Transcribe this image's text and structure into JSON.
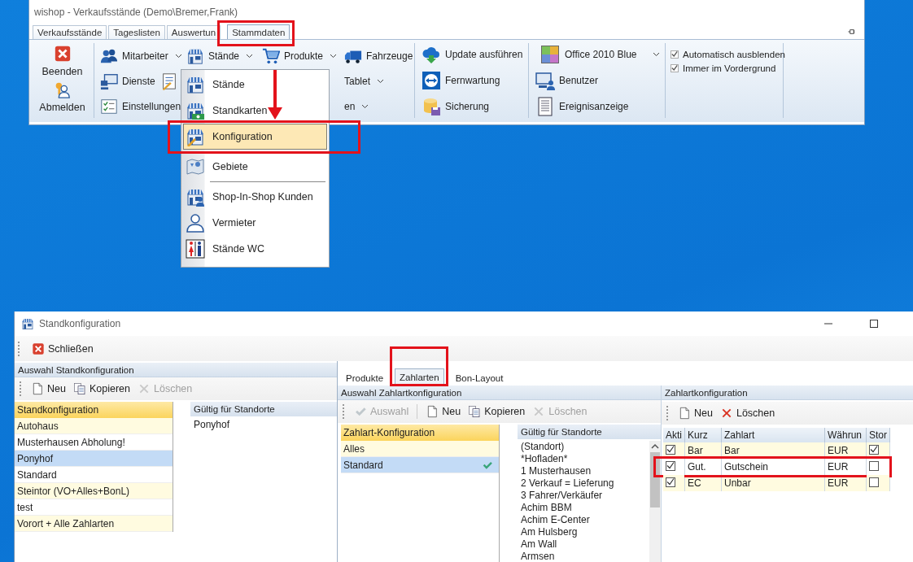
{
  "main_window": {
    "title": "wishop - Verkaufsstände (Demo\\Bremer,Frank)",
    "tabs": [
      {
        "label": "Verkaufsstände",
        "selected": false,
        "highlighted": false
      },
      {
        "label": "Tageslisten",
        "selected": false,
        "highlighted": false
      },
      {
        "label": "Auswertun",
        "selected": false,
        "highlighted": false
      },
      {
        "label": "Stammdaten",
        "selected": true,
        "highlighted": true
      }
    ],
    "ribbon": {
      "groups": [
        {
          "kind": "large",
          "items": [
            {
              "label": "Beenden"
            },
            {
              "label": "Abmelden"
            }
          ]
        },
        {
          "kind": "grid",
          "rows": [
            [
              {
                "label": "Mitarbeiter",
                "dropdown": true
              },
              {
                "label": "Stände",
                "dropdown": true
              },
              {
                "label": "Produkte",
                "dropdown": true
              },
              {
                "label": "Fahrzeuge",
                "dropdown": false
              }
            ],
            [
              {
                "label": "Dienste",
                "dropdown": false
              },
              {
                "label": "Tablet",
                "dropdown": true
              }
            ],
            [
              {
                "label": "Einstellungen",
                "dropdown": false
              },
              {
                "label": "en",
                "dropdown": true
              }
            ]
          ]
        },
        {
          "kind": "list",
          "items": [
            {
              "label": "Update ausführen"
            },
            {
              "label": "Fernwartung"
            },
            {
              "label": "Sicherung"
            }
          ]
        },
        {
          "kind": "theme",
          "combo": {
            "value": "Office 2010 Blue"
          },
          "items": [
            {
              "label": "Benutzer"
            },
            {
              "label": "Ereignisanzeige"
            }
          ]
        },
        {
          "kind": "checks",
          "items": [
            {
              "label": "Automatisch ausblenden",
              "checked": true
            },
            {
              "label": "Immer im Vordergrund",
              "checked": true
            }
          ]
        }
      ]
    }
  },
  "menu": {
    "pointer_arrow": true,
    "items": [
      {
        "kind": "item",
        "label": "Stände",
        "selected": false,
        "highlighted": false
      },
      {
        "kind": "item",
        "label": "Standkarten",
        "selected": false,
        "highlighted": false
      },
      {
        "kind": "item",
        "label": "Konfiguration",
        "selected": true,
        "highlighted": true
      },
      {
        "kind": "separator"
      },
      {
        "kind": "item",
        "label": "Gebiete",
        "selected": false,
        "highlighted": false
      },
      {
        "kind": "separator"
      },
      {
        "kind": "item",
        "label": "Shop-In-Shop Kunden",
        "selected": false,
        "highlighted": false
      },
      {
        "kind": "item",
        "label": "Vermieter",
        "selected": false,
        "highlighted": false
      },
      {
        "kind": "item",
        "label": "Stände WC",
        "selected": false,
        "highlighted": false
      }
    ]
  },
  "config_window": {
    "title": "Standkonfiguration",
    "toolbar": [
      {
        "label": "Schließen"
      }
    ],
    "left_panel": {
      "header": "Auswahl Standkonfiguration",
      "toolbar": [
        {
          "label": "Neu",
          "disabled": false
        },
        {
          "label": "Kopieren",
          "disabled": false
        },
        {
          "label": "Löschen",
          "disabled": true
        }
      ],
      "list": {
        "header": "Standkonfiguration",
        "rows": [
          {
            "label": "Autohaus",
            "selected": false
          },
          {
            "label": "Musterhausen Abholung!",
            "selected": false
          },
          {
            "label": "Ponyhof",
            "selected": true
          },
          {
            "label": "Standard",
            "selected": false
          },
          {
            "label": "Steintor (VO+Alles+BonL)",
            "selected": false
          },
          {
            "label": "test",
            "selected": false
          },
          {
            "label": "Vorort + Alle Zahlarten",
            "selected": false
          }
        ]
      },
      "locations": {
        "header": "Gültig für Standorte",
        "rows": [
          "Ponyhof"
        ]
      }
    },
    "tabs": [
      {
        "label": "Produkte",
        "selected": false,
        "highlighted": false
      },
      {
        "label": "Zahlarten",
        "selected": true,
        "highlighted": true
      },
      {
        "label": "Bon-Layout",
        "selected": false,
        "highlighted": false
      }
    ],
    "payment_config_panel": {
      "header": "Auswahl Zahlartkonfiguration",
      "toolbar": [
        {
          "label": "Auswahl",
          "disabled": true
        },
        {
          "label": "Neu",
          "disabled": false
        },
        {
          "label": "Kopieren",
          "disabled": false
        },
        {
          "label": "Löschen",
          "disabled": true
        }
      ],
      "list": {
        "header": "Zahlart-Konfiguration",
        "rows": [
          {
            "label": "Alles",
            "selected": false,
            "active": false
          },
          {
            "label": "Standard",
            "selected": true,
            "active": true
          }
        ]
      },
      "locations": {
        "header": "Gültig für Standorte",
        "rows": [
          "(Standort)",
          "*Hofladen*",
          "1 Musterhausen",
          "2 Verkauf = Lieferung",
          "3 Fahrer/Verkäufer",
          "Achim BBM",
          "Achim E-Center",
          "Am Hulsberg",
          "Am Wall",
          "Armsen"
        ]
      }
    },
    "payment_types_panel": {
      "header": "Zahlartkonfiguration",
      "toolbar": [
        {
          "label": "Neu",
          "disabled": false
        },
        {
          "label": "Löschen",
          "disabled": false
        }
      ],
      "table": {
        "columns": [
          "Akti",
          "Kurz",
          "Zahlart",
          "Währun",
          "Stor"
        ],
        "rows": [
          {
            "active": true,
            "short": "Bar",
            "name": "Bar",
            "currency": "EUR",
            "storno": true,
            "highlighted": false
          },
          {
            "active": true,
            "short": "Gut.",
            "name": "Gutschein",
            "currency": "EUR",
            "storno": false,
            "highlighted": true
          },
          {
            "active": true,
            "short": "EC",
            "name": "Unbar",
            "currency": "EUR",
            "storno": false,
            "highlighted": false
          }
        ]
      }
    }
  }
}
